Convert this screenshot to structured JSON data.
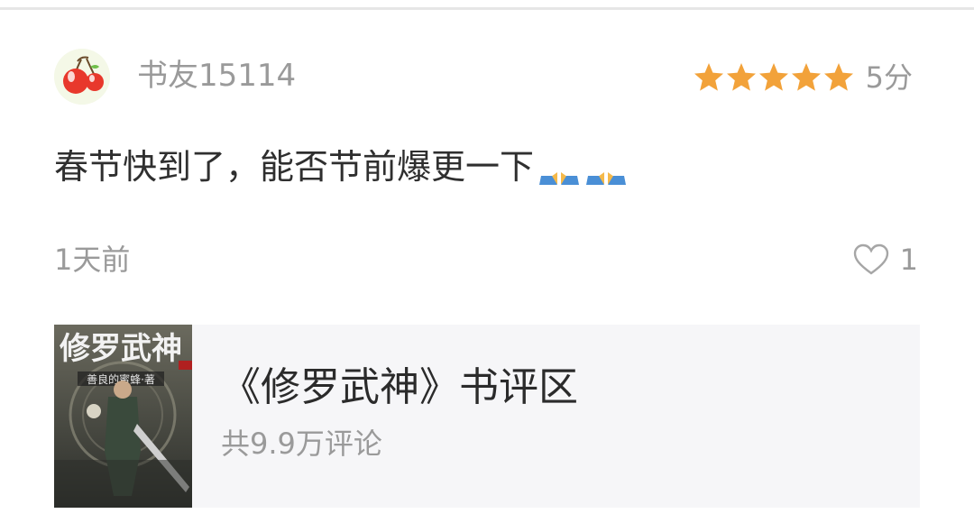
{
  "review": {
    "username": "书友15114",
    "avatar_icon": "cherry-avatar-icon",
    "rating_stars": 5,
    "rating_max": 5,
    "score_label": "5分",
    "star_color": "#f2a23a",
    "comment_text": "春节快到了，能否节前爆更一下",
    "comment_emoji": [
      "pray-emoji",
      "pray-emoji"
    ],
    "time_label": "1天前",
    "like_count": "1"
  },
  "book_card": {
    "cover_title_art": "修罗武神",
    "cover_author_art": "善良的蜜蜂·著",
    "title": "《修罗武神》书评区",
    "comment_count_label": "共9.9万评论"
  }
}
